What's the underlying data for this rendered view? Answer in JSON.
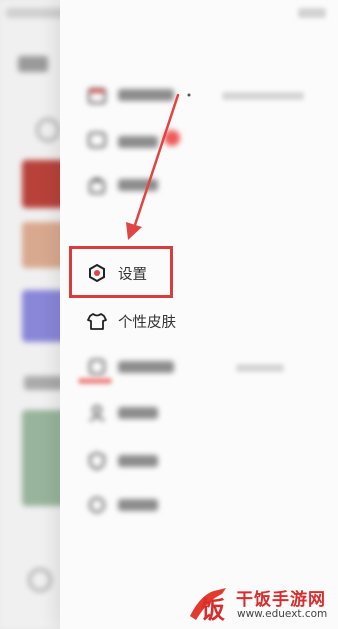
{
  "drawer": {
    "items": [
      {
        "label": "设置",
        "icon": "hexagon-gear-icon"
      },
      {
        "label": "个性皮肤",
        "icon": "tshirt-icon"
      }
    ]
  },
  "annotation": {
    "arrow_color": "#e04545",
    "highlight_color": "#d93c3c"
  },
  "watermark": {
    "logo_char": "饭",
    "title": "干饭手游网",
    "url": "www.eduext.com"
  }
}
